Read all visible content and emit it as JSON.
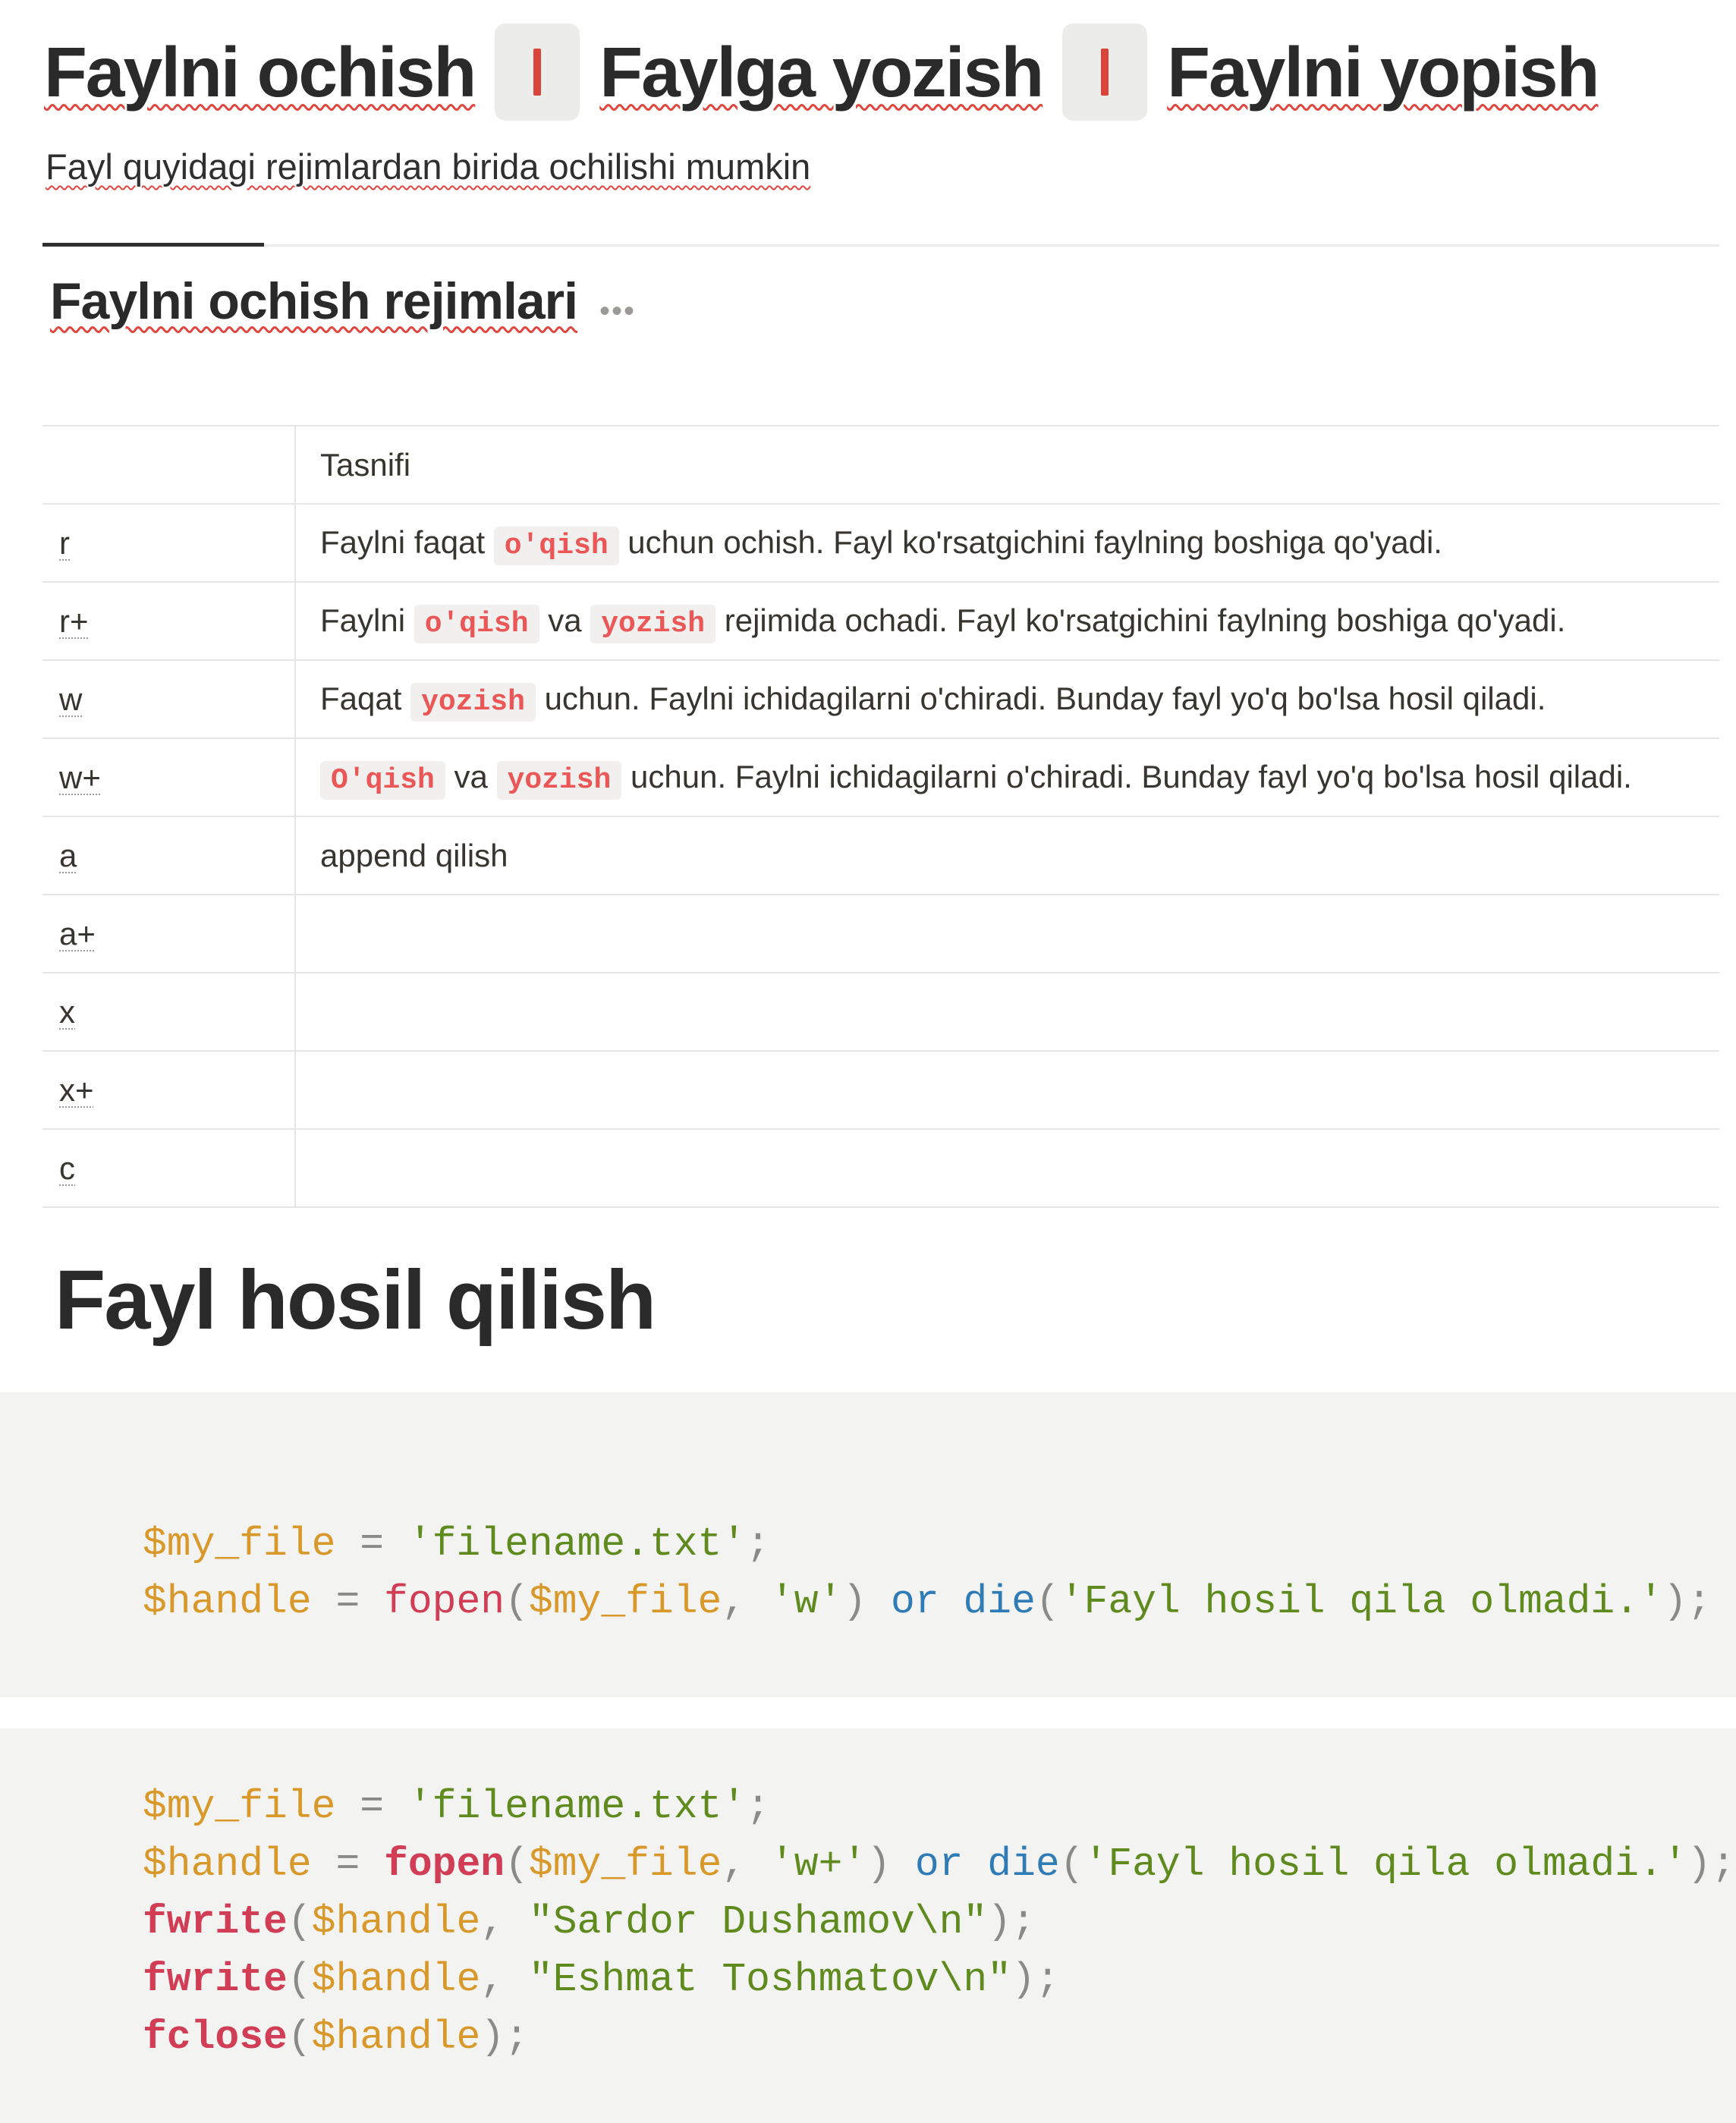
{
  "header": {
    "title_parts": [
      "Faylni ochish",
      "Faylga yozish",
      "Faylni yopish"
    ],
    "subtitle": "Fayl quyidagi rejimlardan birida ochilishi mumkin"
  },
  "section": {
    "title": "Faylni ochish rejimlari",
    "more_icon": "more-dots-icon"
  },
  "table": {
    "header": [
      "",
      "Tasnifi"
    ],
    "rows": [
      {
        "mode": "r",
        "desc": [
          "Faylni faqat ",
          "o'qish",
          " uchun ochish. Fayl ko'rsatgichini faylning boshiga qo'yadi."
        ]
      },
      {
        "mode": "r+",
        "desc": [
          "Faylni ",
          "o'qish",
          " va ",
          "yozish",
          " rejimida ochadi. Fayl ko'rsatgichini faylning boshiga qo'yadi."
        ]
      },
      {
        "mode": "w",
        "desc": [
          "Faqat ",
          "yozish",
          " uchun. Faylni ichidagilarni o'chiradi. Bunday fayl yo'q bo'lsa hosil qiladi."
        ]
      },
      {
        "mode": "w+",
        "desc": [
          "",
          "O'qish",
          " va ",
          "yozish",
          " uchun. Faylni ichidagilarni o'chiradi. Bunday fayl yo'q bo'lsa hosil qiladi."
        ]
      },
      {
        "mode": "a",
        "desc": "append qilish"
      },
      {
        "mode": "a+",
        "desc": ""
      },
      {
        "mode": "x",
        "desc": ""
      },
      {
        "mode": "x+",
        "desc": ""
      },
      {
        "mode": "c",
        "desc": ""
      }
    ]
  },
  "section2": {
    "title": "Fayl hosil qilish"
  },
  "code_blocks": [
    [
      [
        [
          "var",
          "$my_file"
        ],
        [
          "pun",
          " = "
        ],
        [
          "str",
          "'filename.txt'"
        ],
        [
          "pun",
          ";"
        ]
      ],
      [
        [
          "var",
          "$handle"
        ],
        [
          "pun",
          " = "
        ],
        [
          "fn",
          "fopen"
        ],
        [
          "pun",
          "("
        ],
        [
          "var",
          "$my_file"
        ],
        [
          "pun",
          ", "
        ],
        [
          "str",
          "'w'"
        ],
        [
          "pun",
          ") "
        ],
        [
          "kw",
          "or"
        ],
        [
          "pun",
          " "
        ],
        [
          "kw",
          "die"
        ],
        [
          "pun",
          "("
        ],
        [
          "str",
          "'Fayl hosil qila olmadi.'"
        ],
        [
          "pun",
          ");"
        ]
      ]
    ],
    [
      [
        [
          "var",
          "$my_file"
        ],
        [
          "pun",
          " = "
        ],
        [
          "str",
          "'filename.txt'"
        ],
        [
          "pun",
          ";"
        ]
      ],
      [
        [
          "var",
          "$handle"
        ],
        [
          "pun",
          " = "
        ],
        [
          "fnb",
          "fopen"
        ],
        [
          "pun",
          "("
        ],
        [
          "var",
          "$my_file"
        ],
        [
          "pun",
          ", "
        ],
        [
          "str",
          "'w+'"
        ],
        [
          "pun",
          ") "
        ],
        [
          "kw",
          "or"
        ],
        [
          "pun",
          " "
        ],
        [
          "kw",
          "die"
        ],
        [
          "pun",
          "("
        ],
        [
          "str",
          "'Fayl hosil qila olmadi.'"
        ],
        [
          "pun",
          ");"
        ]
      ],
      [
        [
          "fnb",
          "fwrite"
        ],
        [
          "pun",
          "("
        ],
        [
          "var",
          "$handle"
        ],
        [
          "pun",
          ", "
        ],
        [
          "str",
          "\"Sardor Dushamov\\n\""
        ],
        [
          "pun",
          ");"
        ]
      ],
      [
        [
          "fnb",
          "fwrite"
        ],
        [
          "pun",
          "("
        ],
        [
          "var",
          "$handle"
        ],
        [
          "pun",
          ", "
        ],
        [
          "str",
          "\"Eshmat Toshmatov\\n\""
        ],
        [
          "pun",
          ");"
        ]
      ],
      [
        [
          "fnb",
          "fclose"
        ],
        [
          "pun",
          "("
        ],
        [
          "var",
          "$handle"
        ],
        [
          "pun",
          ");"
        ]
      ]
    ]
  ],
  "colors": {
    "separator": "#d9443b",
    "inline_code": "#eb5757",
    "code_variable": "#d9982a",
    "code_function": "#d13d55",
    "code_string": "#5f8a1e",
    "code_keyword": "#2f7bb5",
    "code_background": "#f3f3f1"
  }
}
